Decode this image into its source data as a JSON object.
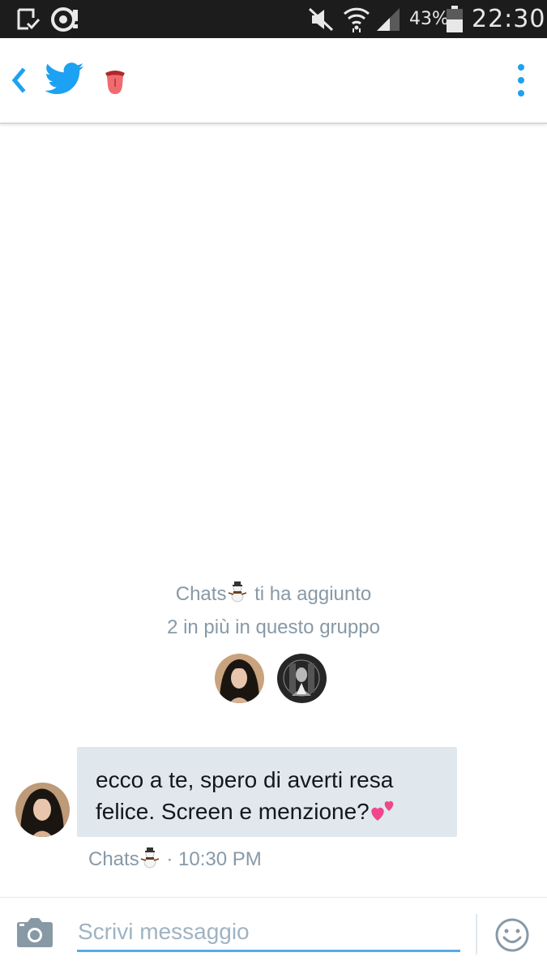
{
  "status_bar": {
    "icons": [
      "download-done-icon",
      "sync-icon",
      "mute-icon",
      "wifi-icon",
      "signal-icon",
      "battery-icon"
    ],
    "battery_percent": "43%",
    "time": "22:30"
  },
  "app_bar": {
    "back_icon": "chevron-left-icon",
    "logo_icon": "twitter-bird-icon",
    "conversation_title_emoji": "tongue-emoji-icon",
    "overflow_icon": "more-vertical-icon",
    "accent_color": "#1da1f2"
  },
  "group_notice": {
    "adder_name": "Chats",
    "adder_emoji": "snowman-emoji-icon",
    "action_text": "ti ha aggiunto",
    "others_text": "2 in più in questo gruppo",
    "members": [
      "member-avatar-1",
      "member-avatar-2"
    ]
  },
  "messages": [
    {
      "sender": "Chats",
      "sender_emoji": "snowman-emoji-icon",
      "text": "ecco a te, spero di averti resa felice. Screen e menzione?",
      "trailing_emoji": "two-hearts-emoji-icon",
      "time_separator": "·",
      "time": "10:30 PM"
    }
  ],
  "composer": {
    "camera_icon": "camera-icon",
    "placeholder": "Scrivi messaggio",
    "value": "",
    "emoji_icon": "smiley-icon"
  },
  "colors": {
    "bubble_bg": "#e1e8ed",
    "muted_text": "#8899a6",
    "input_underline": "#55acee",
    "status_bar_bg": "#1c1c1c"
  }
}
